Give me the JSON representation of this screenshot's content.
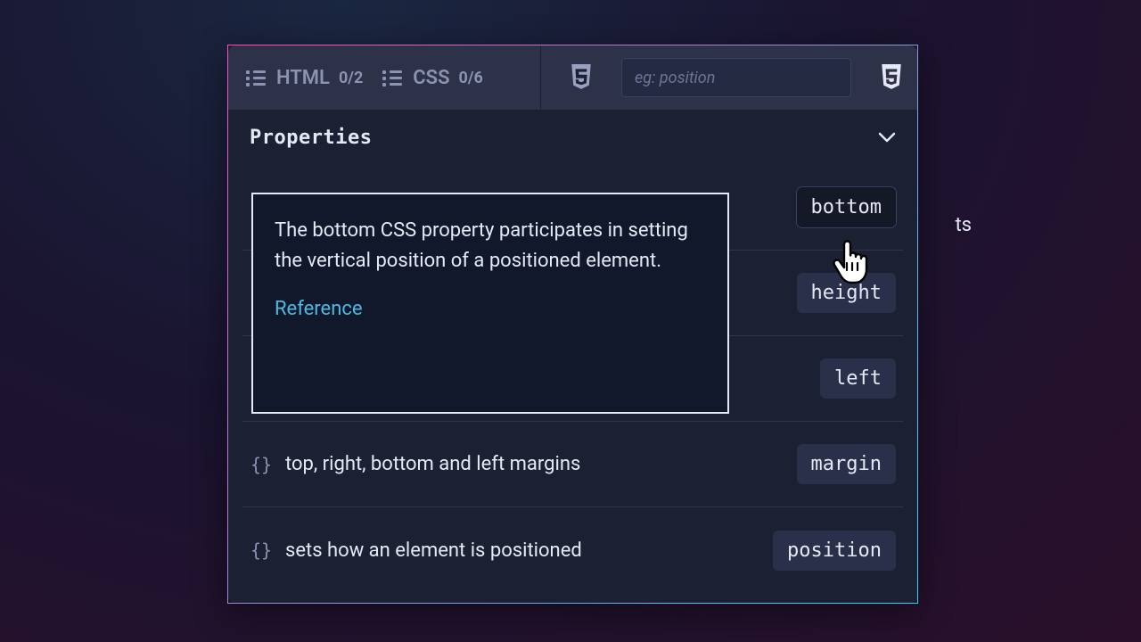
{
  "tabs": {
    "html": {
      "label": "HTML",
      "count": "0/2"
    },
    "css": {
      "label": "CSS",
      "count": "0/6"
    }
  },
  "search": {
    "placeholder": "eg: position"
  },
  "section": {
    "title": "Properties"
  },
  "rows": [
    {
      "desc_fragment_visible": "ts",
      "tag": "bottom"
    },
    {
      "desc": "",
      "tag": "height"
    },
    {
      "desc": "",
      "tag": "left"
    },
    {
      "desc": "top, right, bottom and left margins",
      "tag": "margin"
    },
    {
      "desc": "sets how an element is positioned",
      "tag": "position"
    }
  ],
  "tooltip": {
    "text": "The bottom CSS property participates in setting the vertical position of a positioned element.",
    "reference_label": "Reference"
  },
  "icons": {
    "braces_glyph": "{}"
  }
}
